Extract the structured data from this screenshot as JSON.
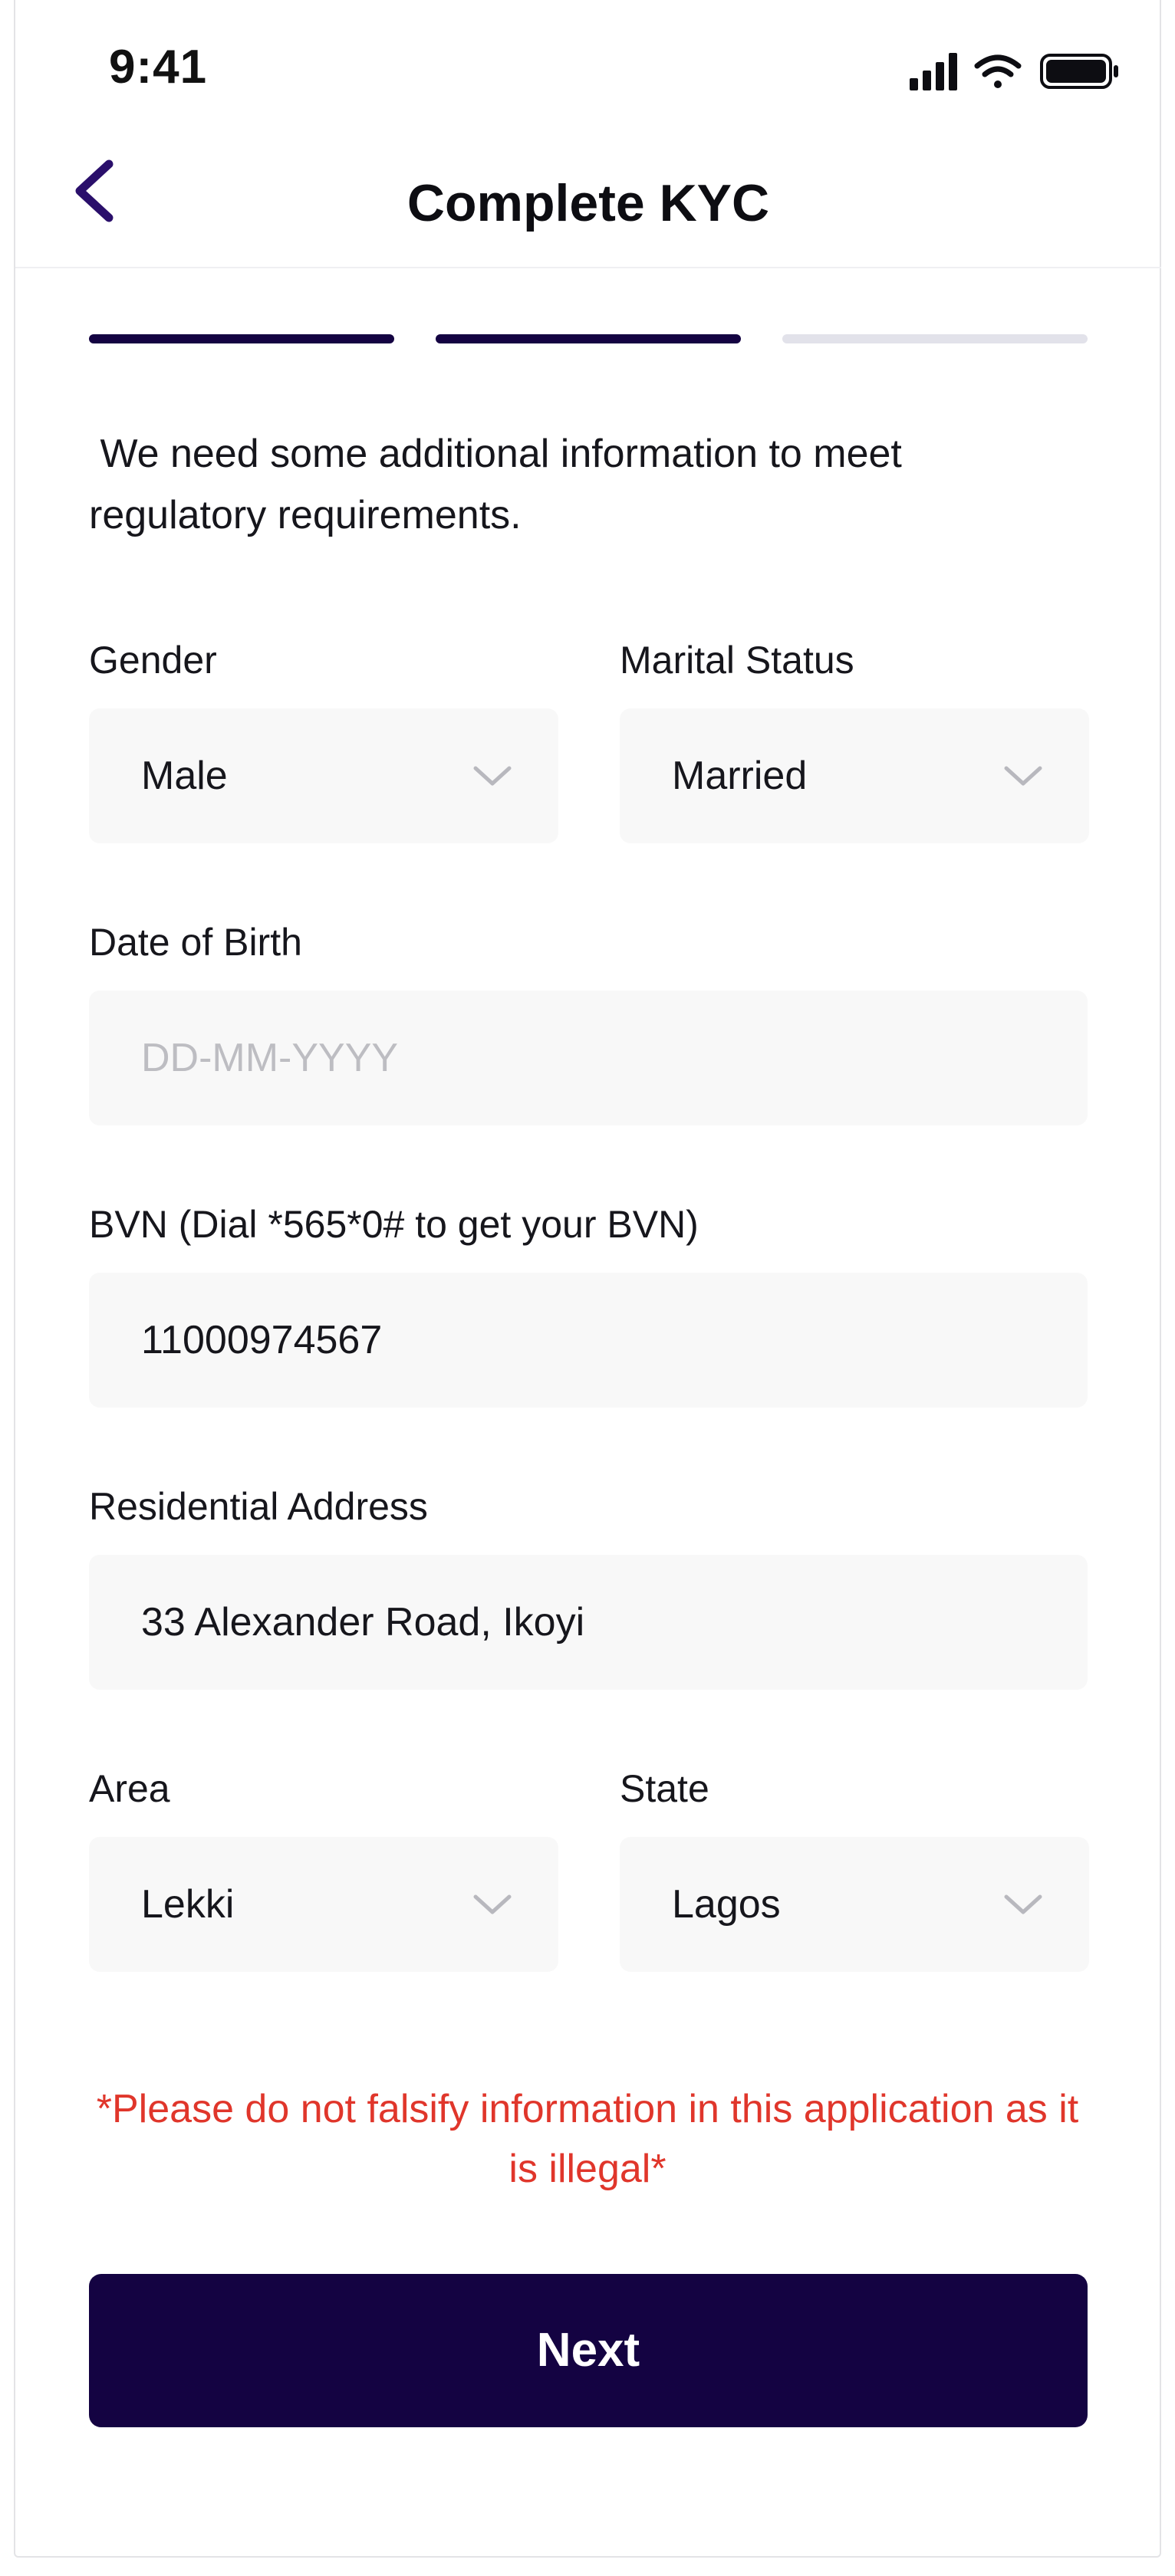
{
  "status_bar": {
    "time": "9:41"
  },
  "header": {
    "title": "Complete KYC",
    "back_icon": "chevron-left-icon"
  },
  "progress": {
    "total_steps": 3,
    "completed_steps": 2,
    "active_color": "#140342",
    "inactive_color": "#e2e2ea"
  },
  "intro_text": " We need some additional information to meet\nregulatory requirements.",
  "form": {
    "gender": {
      "label": "Gender",
      "value": "Male"
    },
    "marital_status": {
      "label": "Marital Status",
      "value": "Married"
    },
    "dob": {
      "label": "Date of Birth",
      "placeholder": "DD-MM-YYYY",
      "value": ""
    },
    "bvn": {
      "label": "BVN (Dial *565*0# to get your BVN)",
      "value": "11000974567"
    },
    "address": {
      "label": "Residential Address",
      "value": "33 Alexander Road, Ikoyi"
    },
    "area": {
      "label": "Area",
      "value": "Lekki"
    },
    "state": {
      "label": "State",
      "value": "Lagos"
    }
  },
  "warning": "*Please do not falsify information in this application as it is illegal*",
  "next_button": {
    "label": "Next"
  },
  "colors": {
    "primary": "#140342",
    "warning": "#e0362b",
    "field_bg": "#f8f8f8"
  }
}
